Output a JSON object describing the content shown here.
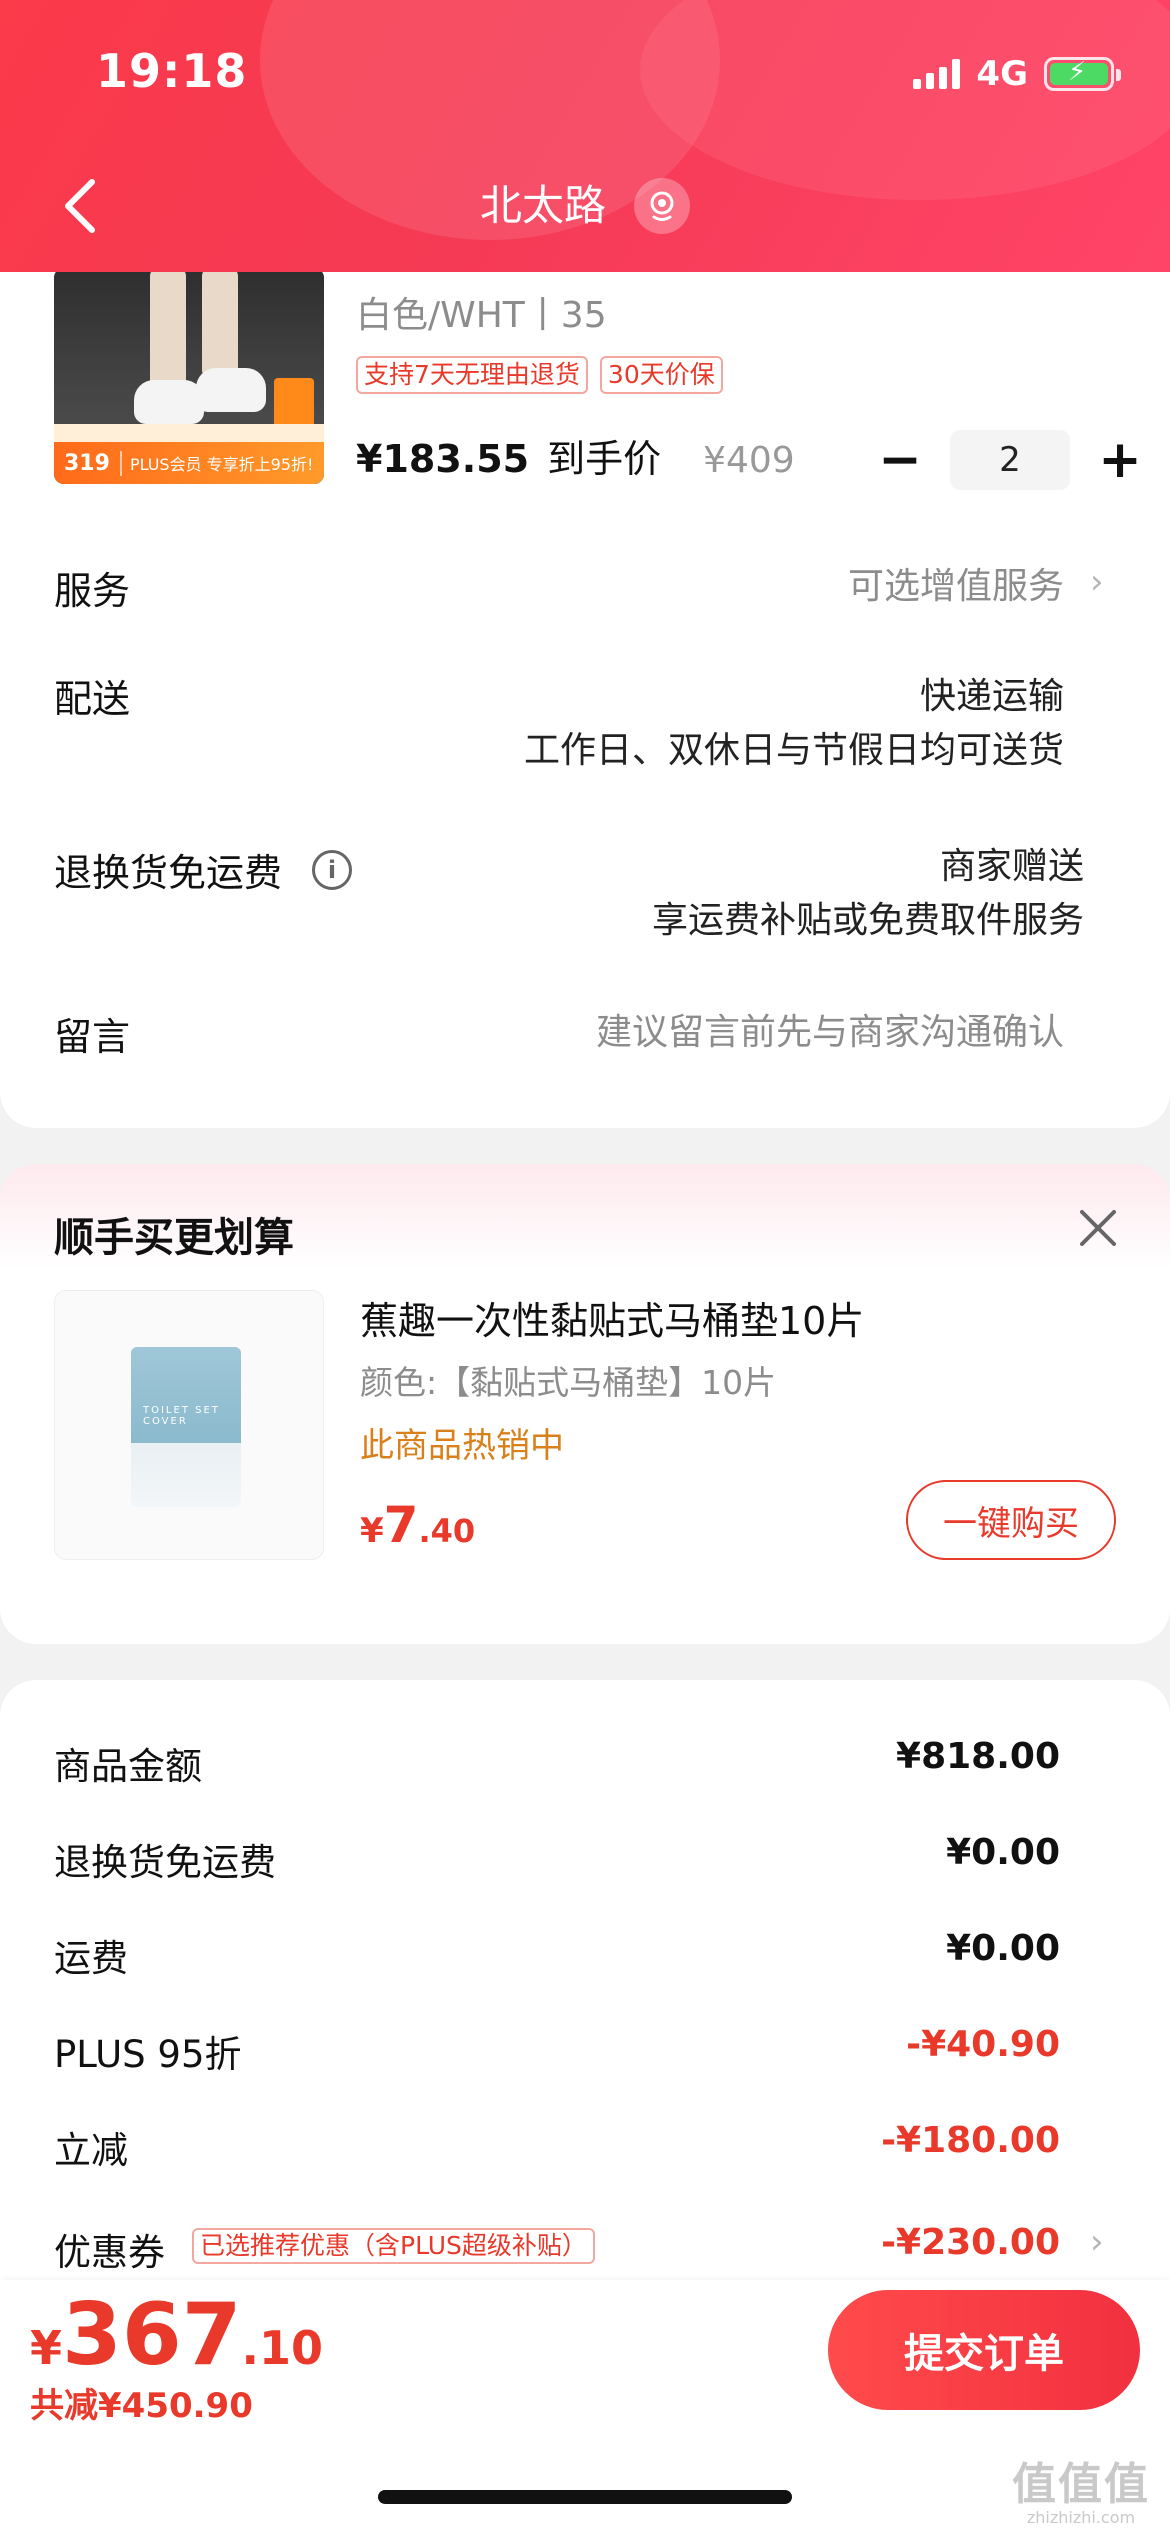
{
  "status_bar": {
    "time": "19:18",
    "network": "4G"
  },
  "header": {
    "title": "北太路"
  },
  "product": {
    "spec": "白色/WHT丨35",
    "tags": [
      "支持7天无理由退货",
      "30天价保"
    ],
    "price": "¥183.55",
    "price_label": "到手价",
    "original_price": "¥409",
    "quantity": "2",
    "image_promo_price": "319",
    "image_promo_text": "PLUS会员 专享折上95折!"
  },
  "rows": {
    "service": {
      "label": "服务",
      "value": "可选增值服务"
    },
    "delivery": {
      "label": "配送",
      "value_line1": "快递运输",
      "value_line2": "工作日、双休日与节假日均可送货"
    },
    "return_shipping": {
      "label": "退换货免运费",
      "value_line1": "商家赠送",
      "value_line2": "享运费补贴或免费取件服务"
    },
    "message": {
      "label": "留言",
      "placeholder": "建议留言前先与商家沟通确认"
    }
  },
  "addon": {
    "title": "顺手买更划算",
    "name": "蕉趣一次性黏贴式马桶垫10片",
    "spec": "颜色:【黏贴式马桶垫】10片",
    "hot": "此商品热销中",
    "price_symbol": "¥",
    "price_int": "7",
    "price_dec": ".40",
    "buy_label": "一键购买",
    "image_text": "TOILET SET COVER"
  },
  "summary": {
    "items": [
      {
        "label": "商品金额",
        "value": "¥818.00"
      },
      {
        "label": "退换货免运费",
        "value": "¥0.00"
      },
      {
        "label": "运费",
        "value": "¥0.00"
      },
      {
        "label": "PLUS 95折",
        "value": "-¥40.90"
      },
      {
        "label": "立减",
        "value": "-¥180.00"
      },
      {
        "label": "优惠券",
        "value": "-¥230.00"
      }
    ],
    "coupon_tag": "已选推荐优惠（含PLUS超级补贴）"
  },
  "footer": {
    "total_symbol": "¥",
    "total_int": "367",
    "total_dec": ".10",
    "saved": "共减¥450.90",
    "submit_label": "提交订单"
  },
  "watermark": {
    "line1": "值值值",
    "line2": "zhizhizhi.com"
  },
  "colors": {
    "brand_red": "#e8392a",
    "header_red": "#f53a55",
    "hot_orange": "#d9801a"
  }
}
